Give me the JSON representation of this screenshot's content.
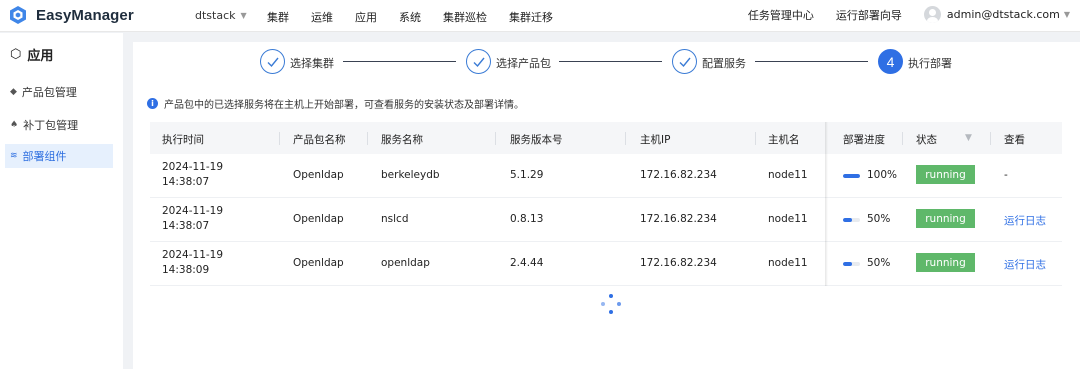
{
  "app": {
    "title": "EasyManager"
  },
  "header": {
    "tenant": "dtstack",
    "nav": [
      "集群",
      "运维",
      "应用",
      "系统",
      "集群巡检",
      "集群迁移"
    ],
    "right_links": [
      "任务管理中心",
      "运行部署向导"
    ],
    "user": "admin@dtstack.com"
  },
  "sidebar": {
    "title": "应用",
    "items": [
      {
        "label": "产品包管理",
        "active": false
      },
      {
        "label": "补丁包管理",
        "active": false
      },
      {
        "label": "部署组件",
        "active": true
      }
    ]
  },
  "steps": [
    {
      "label": "选择集群",
      "state": "done"
    },
    {
      "label": "选择产品包",
      "state": "done"
    },
    {
      "label": "配置服务",
      "state": "done"
    },
    {
      "label": "执行部署",
      "number": "4",
      "state": "current"
    }
  ],
  "info": {
    "text": "产品包中的已选择服务将在主机上开始部署，可查看服务的安装状态及部署详情。"
  },
  "table": {
    "columns": [
      "执行时间",
      "产品包名称",
      "服务名称",
      "服务版本号",
      "主机IP",
      "主机名",
      "部署进度",
      "状态",
      "查看"
    ],
    "rows": [
      {
        "date": "2024-11-19",
        "time": "14:38:07",
        "package": "Openldap",
        "service": "berkeleydb",
        "version": "5.1.29",
        "ip": "172.16.82.234",
        "host": "node11",
        "progress": 100,
        "progress_text": "100%",
        "status": "running",
        "view": "-"
      },
      {
        "date": "2024-11-19",
        "time": "14:38:07",
        "package": "Openldap",
        "service": "nslcd",
        "version": "0.8.13",
        "ip": "172.16.82.234",
        "host": "node11",
        "progress": 50,
        "progress_text": "50%",
        "status": "running",
        "view": "运行日志"
      },
      {
        "date": "2024-11-19",
        "time": "14:38:09",
        "package": "Openldap",
        "service": "openldap",
        "version": "2.4.44",
        "ip": "172.16.82.234",
        "host": "node11",
        "progress": 50,
        "progress_text": "50%",
        "status": "running",
        "view": "运行日志"
      }
    ]
  },
  "colors": {
    "primary": "#2f6fe4",
    "running": "#5fb86a",
    "active_bg": "#e6f0fd"
  }
}
